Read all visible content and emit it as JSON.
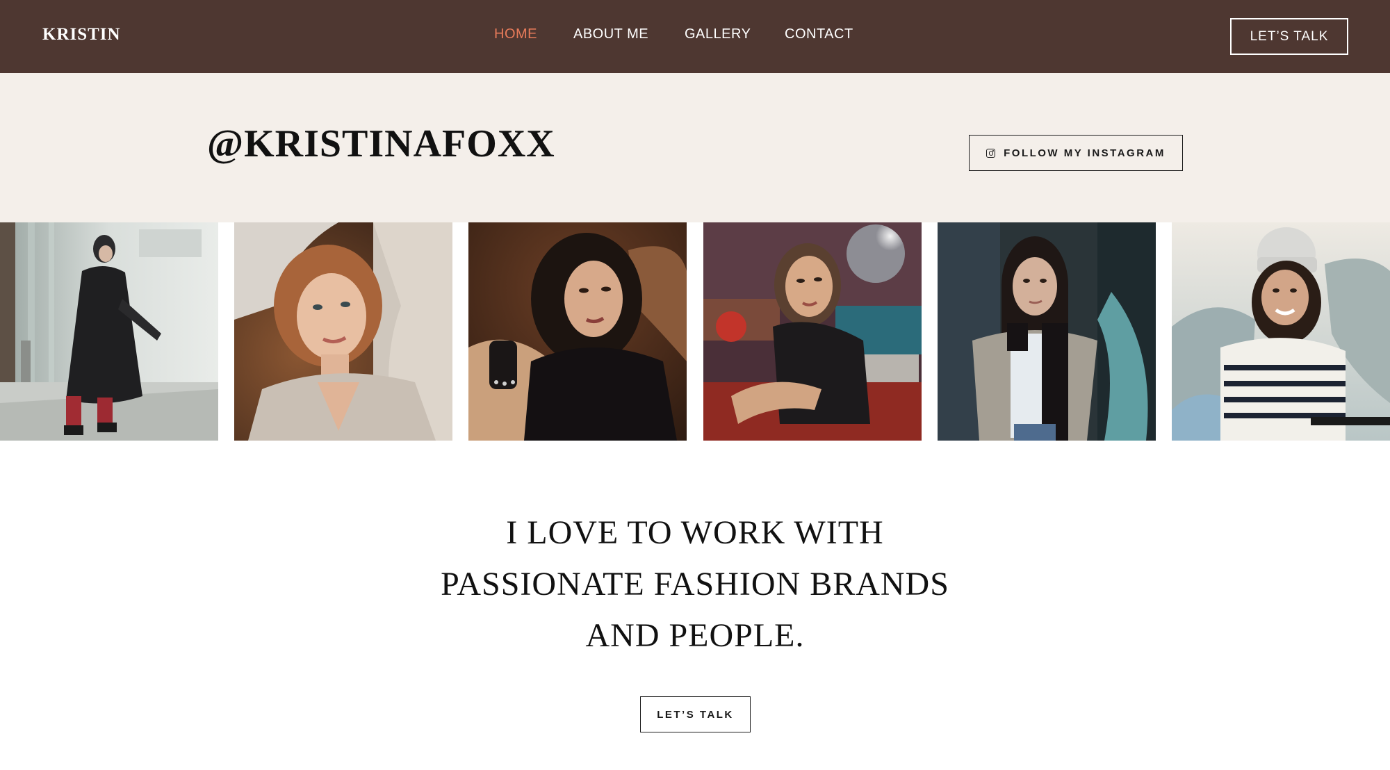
{
  "header": {
    "brand": "KRISTIN",
    "nav": [
      {
        "label": "HOME",
        "active": true
      },
      {
        "label": "ABOUT ME",
        "active": false
      },
      {
        "label": "GALLERY",
        "active": false
      },
      {
        "label": "CONTACT",
        "active": false
      }
    ],
    "cta_label": "LET’S TALK"
  },
  "instagram": {
    "handle": "@KRISTINAFOXX",
    "follow_label": "FOLLOW MY INSTAGRAM",
    "follow_icon": "instagram-icon"
  },
  "gallery": {
    "photos": [
      "woman-in-black-coat-photo",
      "woman-in-knit-sweater-photo",
      "woman-in-black-lace-photo",
      "woman-with-disco-ball-photo",
      "woman-in-trench-coat-photo",
      "woman-in-white-beanie-photo"
    ]
  },
  "mission": {
    "lines": [
      "I LOVE TO WORK WITH",
      "PASSIONATE FASHION BRANDS",
      "AND PEOPLE."
    ],
    "cta_label": "LET’S TALK"
  },
  "colors": {
    "header_bg": "#4e3731",
    "nav_active": "#e87b5a",
    "band_bg": "#f4efea",
    "text": "#111111"
  }
}
